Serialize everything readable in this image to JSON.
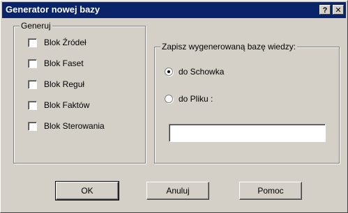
{
  "window": {
    "title": "Generator nowej bazy",
    "help_label": "?",
    "close_label": "✕"
  },
  "generate_group": {
    "legend": "Generuj",
    "items": [
      {
        "label": "Blok Źródeł",
        "checked": false
      },
      {
        "label": "Blok Faset",
        "checked": false
      },
      {
        "label": "Blok Reguł",
        "checked": false
      },
      {
        "label": "Blok Faktów",
        "checked": false
      },
      {
        "label": "Blok Sterowania",
        "checked": false
      }
    ]
  },
  "save_group": {
    "legend": "Zapisz wygenerowaną bazę wiedzy:",
    "options": [
      {
        "label": "do Schowka",
        "selected": true
      },
      {
        "label": "do Pliku :",
        "selected": false
      }
    ],
    "file_path_value": ""
  },
  "buttons": {
    "ok": "OK",
    "cancel": "Anuluj",
    "help": "Pomoc"
  }
}
